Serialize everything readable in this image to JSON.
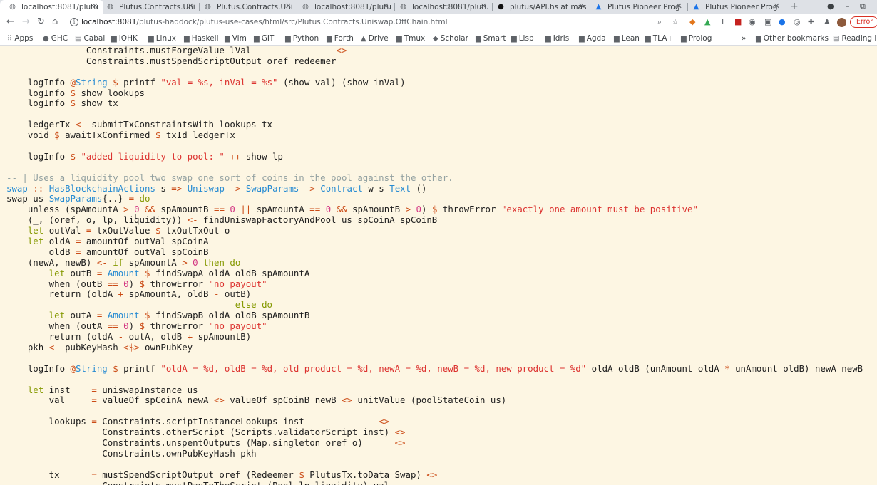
{
  "browser": {
    "tabs": [
      {
        "label": "localhost:8081/plutu",
        "icon": "globe-icon",
        "active": true
      },
      {
        "label": "Plutus.Contracts.Uni",
        "icon": "globe-icon",
        "active": false
      },
      {
        "label": "Plutus.Contracts.Uni",
        "icon": "globe-icon",
        "active": false
      },
      {
        "label": "localhost:8081/plutu",
        "icon": "globe-icon",
        "active": false
      },
      {
        "label": "localhost:8081/plutu",
        "icon": "globe-icon",
        "active": false
      },
      {
        "label": "plutus/API.hs at mas",
        "icon": "github-icon",
        "active": false
      },
      {
        "label": "Plutus Pioneer Prog",
        "icon": "google-drive-icon",
        "active": false
      },
      {
        "label": "Plutus Pioneer Prog",
        "icon": "google-drive-icon",
        "active": false
      }
    ],
    "new_tab": "+",
    "url_host": "localhost:8081",
    "url_path": "/plutus-haddock/plutus-use-cases/html/src/Plutus.Contracts.Uniswap.OffChain.html",
    "error_label": "Error",
    "bookmarks": [
      {
        "label": "Apps",
        "icon": "apps-grid-icon"
      },
      {
        "label": "GHC",
        "icon": "github-icon"
      },
      {
        "label": "Cabal",
        "icon": "book-icon"
      },
      {
        "label": "IOHK",
        "icon": "folder-icon"
      },
      {
        "label": "Linux",
        "icon": "folder-icon"
      },
      {
        "label": "Haskell",
        "icon": "folder-icon"
      },
      {
        "label": "Vim",
        "icon": "folder-icon"
      },
      {
        "label": "GIT",
        "icon": "folder-icon"
      },
      {
        "label": "Python",
        "icon": "folder-icon"
      },
      {
        "label": "Forth",
        "icon": "folder-icon"
      },
      {
        "label": "Drive",
        "icon": "google-drive-icon"
      },
      {
        "label": "Tmux",
        "icon": "folder-icon"
      },
      {
        "label": "Scholar",
        "icon": "scholar-icon"
      },
      {
        "label": "Smart",
        "icon": "folder-icon"
      },
      {
        "label": "Lisp",
        "icon": "folder-icon"
      },
      {
        "label": "Idris",
        "icon": "folder-icon"
      },
      {
        "label": "Agda",
        "icon": "folder-icon"
      },
      {
        "label": "Lean",
        "icon": "folder-icon"
      },
      {
        "label": "TLA+",
        "icon": "folder-icon"
      },
      {
        "label": "Prolog",
        "icon": "folder-icon"
      }
    ],
    "bookmarks_overflow": "»",
    "other_bookmarks": "Other bookmarks",
    "reading_list": "Reading lis"
  },
  "code_lines": [
    [
      [
        "pl",
        "               Constraints.mustForgeValue lVal                "
      ],
      [
        "op",
        "<>"
      ]
    ],
    [
      [
        "pl",
        "               Constraints.mustSpendScriptOutput oref redeemer"
      ]
    ],
    [],
    [
      [
        "pl",
        "    logInfo "
      ],
      [
        "op",
        "@"
      ],
      [
        "ty",
        "String"
      ],
      [
        "pl",
        " "
      ],
      [
        "op",
        "$"
      ],
      [
        "pl",
        " printf "
      ],
      [
        "str",
        "\"val = %s, inVal = %s\""
      ],
      [
        "pl",
        " (show val) (show inVal)"
      ]
    ],
    [
      [
        "pl",
        "    logInfo "
      ],
      [
        "op",
        "$"
      ],
      [
        "pl",
        " show lookups"
      ]
    ],
    [
      [
        "pl",
        "    logInfo "
      ],
      [
        "op",
        "$"
      ],
      [
        "pl",
        " show tx"
      ]
    ],
    [],
    [
      [
        "pl",
        "    ledgerTx "
      ],
      [
        "op",
        "<-"
      ],
      [
        "pl",
        " submitTxConstraintsWith lookups tx"
      ]
    ],
    [
      [
        "pl",
        "    void "
      ],
      [
        "op",
        "$"
      ],
      [
        "pl",
        " awaitTxConfirmed "
      ],
      [
        "op",
        "$"
      ],
      [
        "pl",
        " txId ledgerTx"
      ]
    ],
    [],
    [
      [
        "pl",
        "    logInfo "
      ],
      [
        "op",
        "$"
      ],
      [
        "pl",
        " "
      ],
      [
        "str",
        "\"added liquidity to pool: \""
      ],
      [
        "pl",
        " "
      ],
      [
        "op",
        "++"
      ],
      [
        "pl",
        " show lp"
      ]
    ],
    [],
    [
      [
        "com",
        "-- | Uses a liquidity pool two swap one sort of coins in the pool against the other."
      ]
    ],
    [
      [
        "fn",
        "swap"
      ],
      [
        "pl",
        " "
      ],
      [
        "op",
        "::"
      ],
      [
        "pl",
        " "
      ],
      [
        "ty",
        "HasBlockchainActions"
      ],
      [
        "pl",
        " s "
      ],
      [
        "op",
        "=>"
      ],
      [
        "pl",
        " "
      ],
      [
        "ty",
        "Uniswap"
      ],
      [
        "pl",
        " "
      ],
      [
        "op",
        "->"
      ],
      [
        "pl",
        " "
      ],
      [
        "ty",
        "SwapParams"
      ],
      [
        "pl",
        " "
      ],
      [
        "op",
        "->"
      ],
      [
        "pl",
        " "
      ],
      [
        "ty",
        "Contract"
      ],
      [
        "pl",
        " w s "
      ],
      [
        "ty",
        "Text"
      ],
      [
        "pl",
        " ()"
      ]
    ],
    [
      [
        "pl",
        "swap us "
      ],
      [
        "ty",
        "SwapParams"
      ],
      [
        "pl",
        "{..} "
      ],
      [
        "op",
        "="
      ],
      [
        "pl",
        " "
      ],
      [
        "kw",
        "do"
      ]
    ],
    [
      [
        "pl",
        "    unless (spAmountA "
      ],
      [
        "op",
        ">"
      ],
      [
        "pl",
        " "
      ],
      [
        "num",
        "0"
      ],
      [
        "pl",
        " "
      ],
      [
        "op",
        "&&"
      ],
      [
        "pl",
        " spAmountB "
      ],
      [
        "op",
        "=="
      ],
      [
        "pl",
        " "
      ],
      [
        "num",
        "0"
      ],
      [
        "pl",
        " "
      ],
      [
        "op",
        "||"
      ],
      [
        "pl",
        " spAmountA "
      ],
      [
        "op",
        "=="
      ],
      [
        "pl",
        " "
      ],
      [
        "num",
        "0"
      ],
      [
        "pl",
        " "
      ],
      [
        "op",
        "&&"
      ],
      [
        "pl",
        " spAmountB "
      ],
      [
        "op",
        ">"
      ],
      [
        "pl",
        " "
      ],
      [
        "num",
        "0"
      ],
      [
        "pl",
        ") "
      ],
      [
        "op",
        "$"
      ],
      [
        "pl",
        " throwError "
      ],
      [
        "str",
        "\"exactly one amount must be positive\""
      ]
    ],
    [
      [
        "pl",
        "    (_, (oref, o, lp, liquidity)) "
      ],
      [
        "op",
        "<-"
      ],
      [
        "pl",
        " findUniswapFactoryAndPool us spCoinA spCoinB"
      ]
    ],
    [
      [
        "pl",
        "    "
      ],
      [
        "kw",
        "let"
      ],
      [
        "pl",
        " outVal "
      ],
      [
        "op",
        "="
      ],
      [
        "pl",
        " txOutValue "
      ],
      [
        "op",
        "$"
      ],
      [
        "pl",
        " txOutTxOut o"
      ]
    ],
    [
      [
        "pl",
        "    "
      ],
      [
        "kw",
        "let"
      ],
      [
        "pl",
        " oldA "
      ],
      [
        "op",
        "="
      ],
      [
        "pl",
        " amountOf outVal spCoinA"
      ]
    ],
    [
      [
        "pl",
        "        oldB "
      ],
      [
        "op",
        "="
      ],
      [
        "pl",
        " amountOf outVal spCoinB"
      ]
    ],
    [
      [
        "pl",
        "    (newA, newB) "
      ],
      [
        "op",
        "<-"
      ],
      [
        "pl",
        " "
      ],
      [
        "kw",
        "if"
      ],
      [
        "pl",
        " spAmountA "
      ],
      [
        "op",
        ">"
      ],
      [
        "pl",
        " "
      ],
      [
        "num",
        "0"
      ],
      [
        "pl",
        " "
      ],
      [
        "kw",
        "then do"
      ]
    ],
    [
      [
        "pl",
        "        "
      ],
      [
        "kw",
        "let"
      ],
      [
        "pl",
        " outB "
      ],
      [
        "op",
        "="
      ],
      [
        "pl",
        " "
      ],
      [
        "ty",
        "Amount"
      ],
      [
        "pl",
        " "
      ],
      [
        "op",
        "$"
      ],
      [
        "pl",
        " findSwapA oldA oldB spAmountA"
      ]
    ],
    [
      [
        "pl",
        "        when (outB "
      ],
      [
        "op",
        "=="
      ],
      [
        "pl",
        " "
      ],
      [
        "num",
        "0"
      ],
      [
        "pl",
        ") "
      ],
      [
        "op",
        "$"
      ],
      [
        "pl",
        " throwError "
      ],
      [
        "str",
        "\"no payout\""
      ]
    ],
    [
      [
        "pl",
        "        return (oldA "
      ],
      [
        "op",
        "+"
      ],
      [
        "pl",
        " spAmountA, oldB "
      ],
      [
        "op",
        "-"
      ],
      [
        "pl",
        " outB)"
      ]
    ],
    [
      [
        "pl",
        "                                           "
      ],
      [
        "kw",
        "else do"
      ]
    ],
    [
      [
        "pl",
        "        "
      ],
      [
        "kw",
        "let"
      ],
      [
        "pl",
        " outA "
      ],
      [
        "op",
        "="
      ],
      [
        "pl",
        " "
      ],
      [
        "ty",
        "Amount"
      ],
      [
        "pl",
        " "
      ],
      [
        "op",
        "$"
      ],
      [
        "pl",
        " findSwapB oldA oldB spAmountB"
      ]
    ],
    [
      [
        "pl",
        "        when (outA "
      ],
      [
        "op",
        "=="
      ],
      [
        "pl",
        " "
      ],
      [
        "num",
        "0"
      ],
      [
        "pl",
        ") "
      ],
      [
        "op",
        "$"
      ],
      [
        "pl",
        " throwError "
      ],
      [
        "str",
        "\"no payout\""
      ]
    ],
    [
      [
        "pl",
        "        return (oldA "
      ],
      [
        "op",
        "-"
      ],
      [
        "pl",
        " outA, oldB "
      ],
      [
        "op",
        "+"
      ],
      [
        "pl",
        " spAmountB)"
      ]
    ],
    [
      [
        "pl",
        "    pkh "
      ],
      [
        "op",
        "<-"
      ],
      [
        "pl",
        " pubKeyHash "
      ],
      [
        "op",
        "<$>"
      ],
      [
        "pl",
        " ownPubKey"
      ]
    ],
    [],
    [
      [
        "pl",
        "    logInfo "
      ],
      [
        "op",
        "@"
      ],
      [
        "ty",
        "String"
      ],
      [
        "pl",
        " "
      ],
      [
        "op",
        "$"
      ],
      [
        "pl",
        " printf "
      ],
      [
        "str",
        "\"oldA = %d, oldB = %d, old product = %d, newA = %d, newB = %d, new product = %d\""
      ],
      [
        "pl",
        " oldA oldB (unAmount oldA "
      ],
      [
        "op",
        "*"
      ],
      [
        "pl",
        " unAmount oldB) newA newB"
      ]
    ],
    [],
    [
      [
        "pl",
        "    "
      ],
      [
        "kw",
        "let"
      ],
      [
        "pl",
        " inst    "
      ],
      [
        "op",
        "="
      ],
      [
        "pl",
        " uniswapInstance us"
      ]
    ],
    [
      [
        "pl",
        "        val     "
      ],
      [
        "op",
        "="
      ],
      [
        "pl",
        " valueOf spCoinA newA "
      ],
      [
        "op",
        "<>"
      ],
      [
        "pl",
        " valueOf spCoinB newB "
      ],
      [
        "op",
        "<>"
      ],
      [
        "pl",
        " unitValue (poolStateCoin us)"
      ]
    ],
    [],
    [
      [
        "pl",
        "        lookups "
      ],
      [
        "op",
        "="
      ],
      [
        "pl",
        " Constraints.scriptInstanceLookups inst              "
      ],
      [
        "op",
        "<>"
      ]
    ],
    [
      [
        "pl",
        "                  Constraints.otherScript (Scripts.validatorScript inst) "
      ],
      [
        "op",
        "<>"
      ]
    ],
    [
      [
        "pl",
        "                  Constraints.unspentOutputs (Map.singleton oref o)      "
      ],
      [
        "op",
        "<>"
      ]
    ],
    [
      [
        "pl",
        "                  Constraints.ownPubKeyHash pkh"
      ]
    ],
    [],
    [
      [
        "pl",
        "        tx      "
      ],
      [
        "op",
        "="
      ],
      [
        "pl",
        " mustSpendScriptOutput oref (Redeemer "
      ],
      [
        "op",
        "$"
      ],
      [
        "pl",
        " PlutusTx.toData Swap) "
      ],
      [
        "op",
        "<>"
      ]
    ],
    [
      [
        "pl",
        "                  Constraints.mustPayToTheScript (Pool lp liquidity) val"
      ]
    ]
  ],
  "colors": {
    "page_bg": "#fdf6e3",
    "keyword": "#859900",
    "type": "#268bd2",
    "string": "#dc322f",
    "operator": "#cb4b16",
    "number": "#d33682",
    "comment": "#93a1a1"
  }
}
